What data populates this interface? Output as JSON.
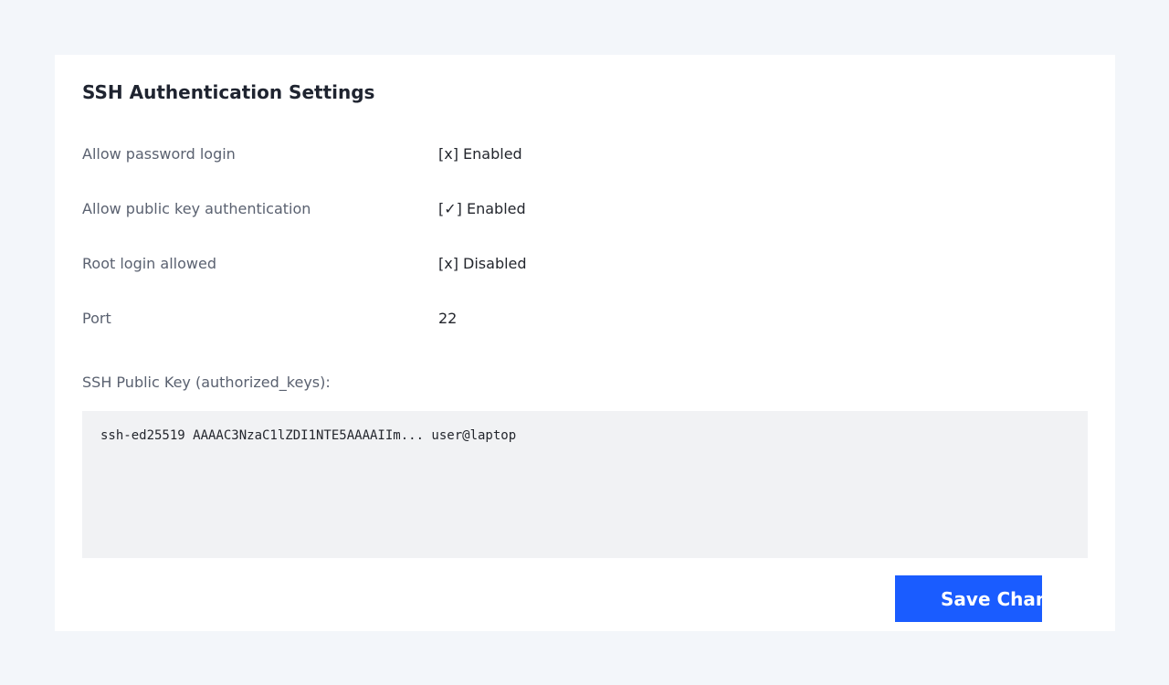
{
  "page": {
    "title": "SSH Authentication Settings"
  },
  "settings": [
    {
      "label": "Allow password login",
      "value": "[x] Enabled"
    },
    {
      "label": "Allow public key authentication",
      "value": "[✓] Enabled"
    },
    {
      "label": "Root login allowed",
      "value": "[x] Disabled"
    },
    {
      "label": "Port",
      "value": "22"
    }
  ],
  "public_key": {
    "label": "SSH Public Key (authorized_keys):",
    "value": "ssh-ed25519 AAAAC3NzaC1lZDI1NTE5AAAAIIm... user@laptop"
  },
  "actions": {
    "save_label": "Save Changes"
  },
  "colors": {
    "background": "#f3f6fa",
    "card": "#ffffff",
    "accent": "#1a5cff",
    "code_background": "#f1f2f4"
  }
}
